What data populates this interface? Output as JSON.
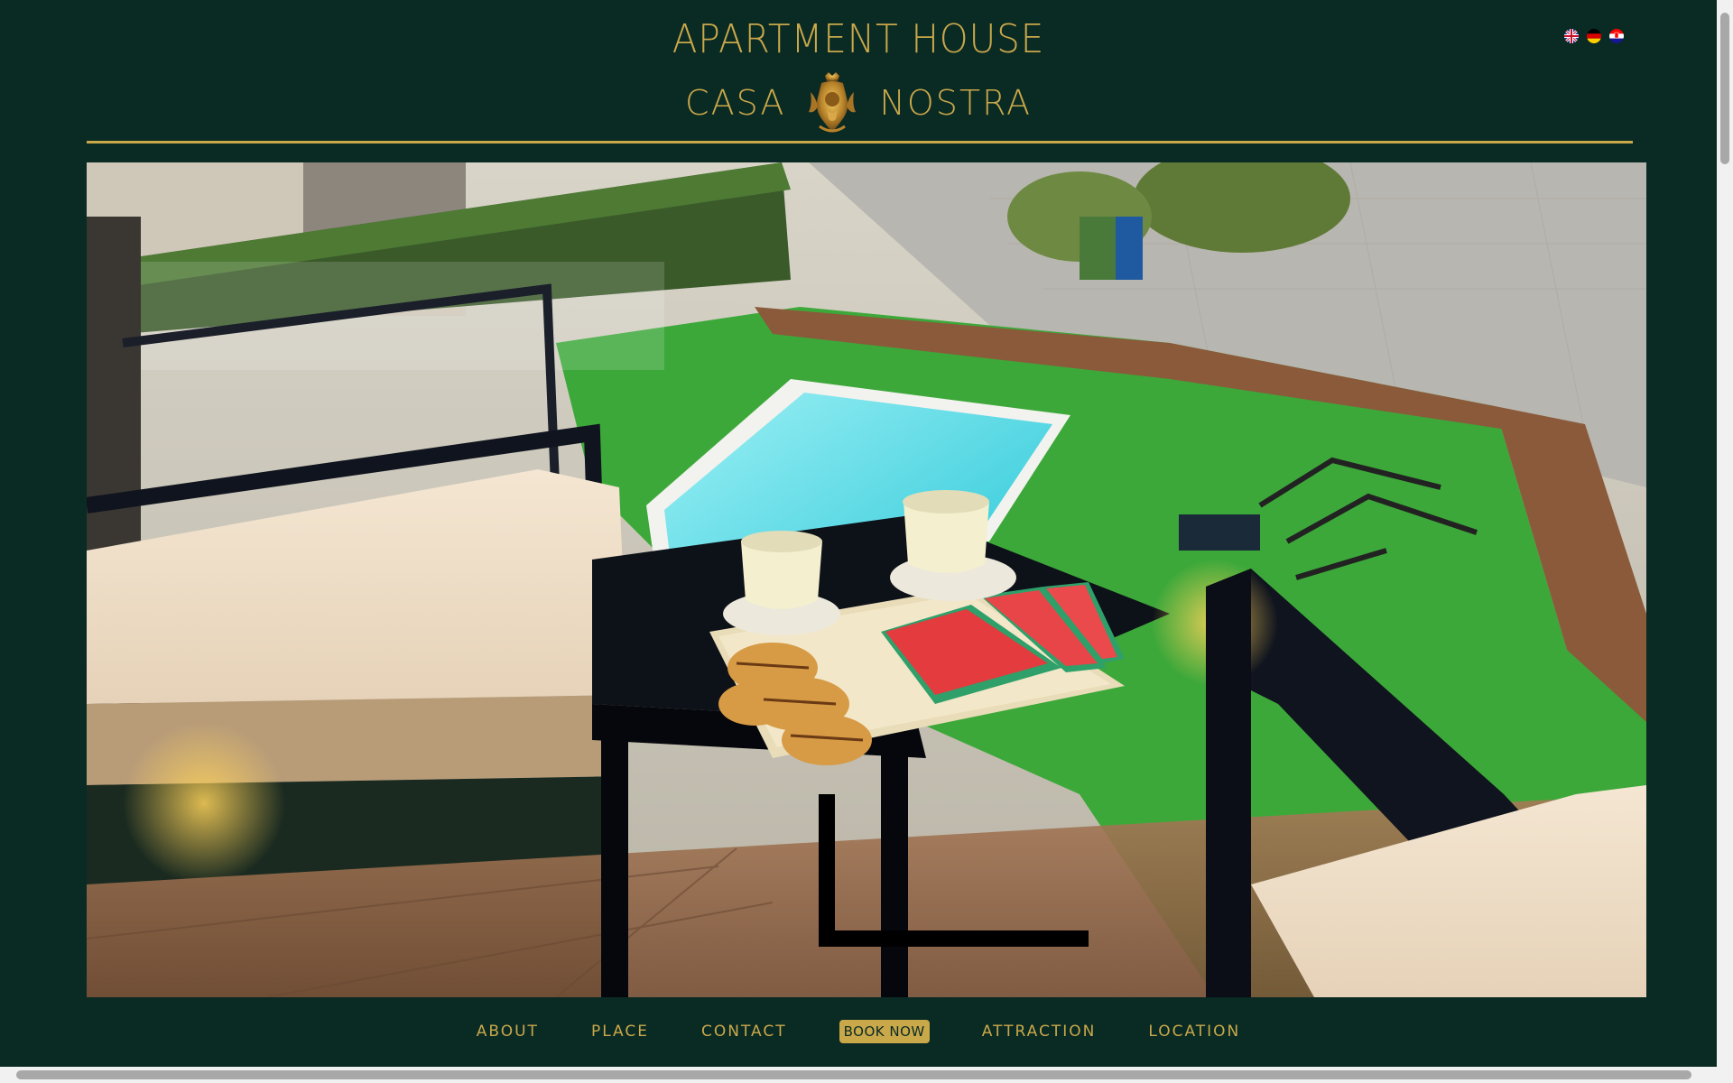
{
  "brand": {
    "line1": "APARTMENT HOUSE",
    "word_left": "CASA",
    "word_right": "NOSTRA",
    "crest_icon": "crest-icon"
  },
  "languages": [
    {
      "code": "en",
      "icon": "uk-flag-icon"
    },
    {
      "code": "de",
      "icon": "german-flag-icon"
    },
    {
      "code": "hr",
      "icon": "croatian-flag-icon"
    }
  ],
  "nav": {
    "items": [
      "ABOUT",
      "PLACE",
      "CONTACT",
      "BOOK NOW",
      "ATTRACTION",
      "LOCATION"
    ]
  },
  "colors": {
    "background": "#0a2a24",
    "accent_gold": "#c9a84a"
  }
}
